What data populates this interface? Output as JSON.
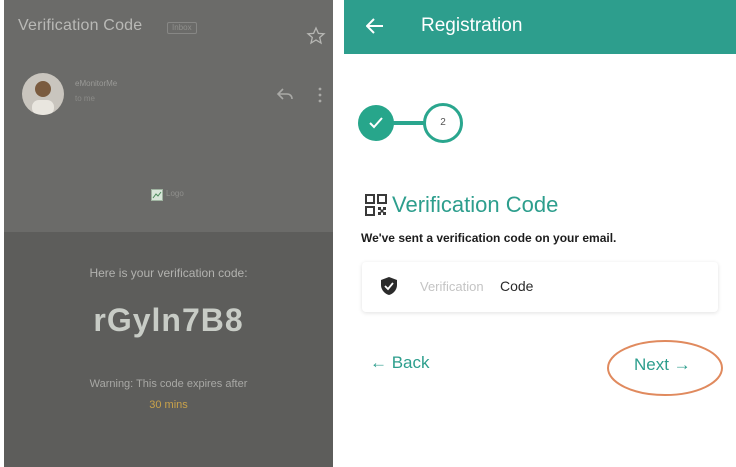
{
  "email": {
    "subject": "Verification Code",
    "tag": "Inbox",
    "sender": "eMonitorMe",
    "recipient": "to me",
    "image_alt": "Logo",
    "intro": "Here is your verification code:",
    "code": "rGyln7B8",
    "warning": "Warning: This code expires after",
    "warning_time": "30 mins"
  },
  "header": {
    "title": "Registration"
  },
  "steps": {
    "current_number": "2"
  },
  "form": {
    "title": "Verification Code",
    "subtitle": "We've sent a verification code on your email.",
    "field_placeholder": "Verification",
    "field_label": "Code"
  },
  "actions": {
    "back_label": "← Back",
    "next_label": "Next →"
  },
  "colors": {
    "primary": "#2d9e8d",
    "highlight": "#e08a5e"
  }
}
